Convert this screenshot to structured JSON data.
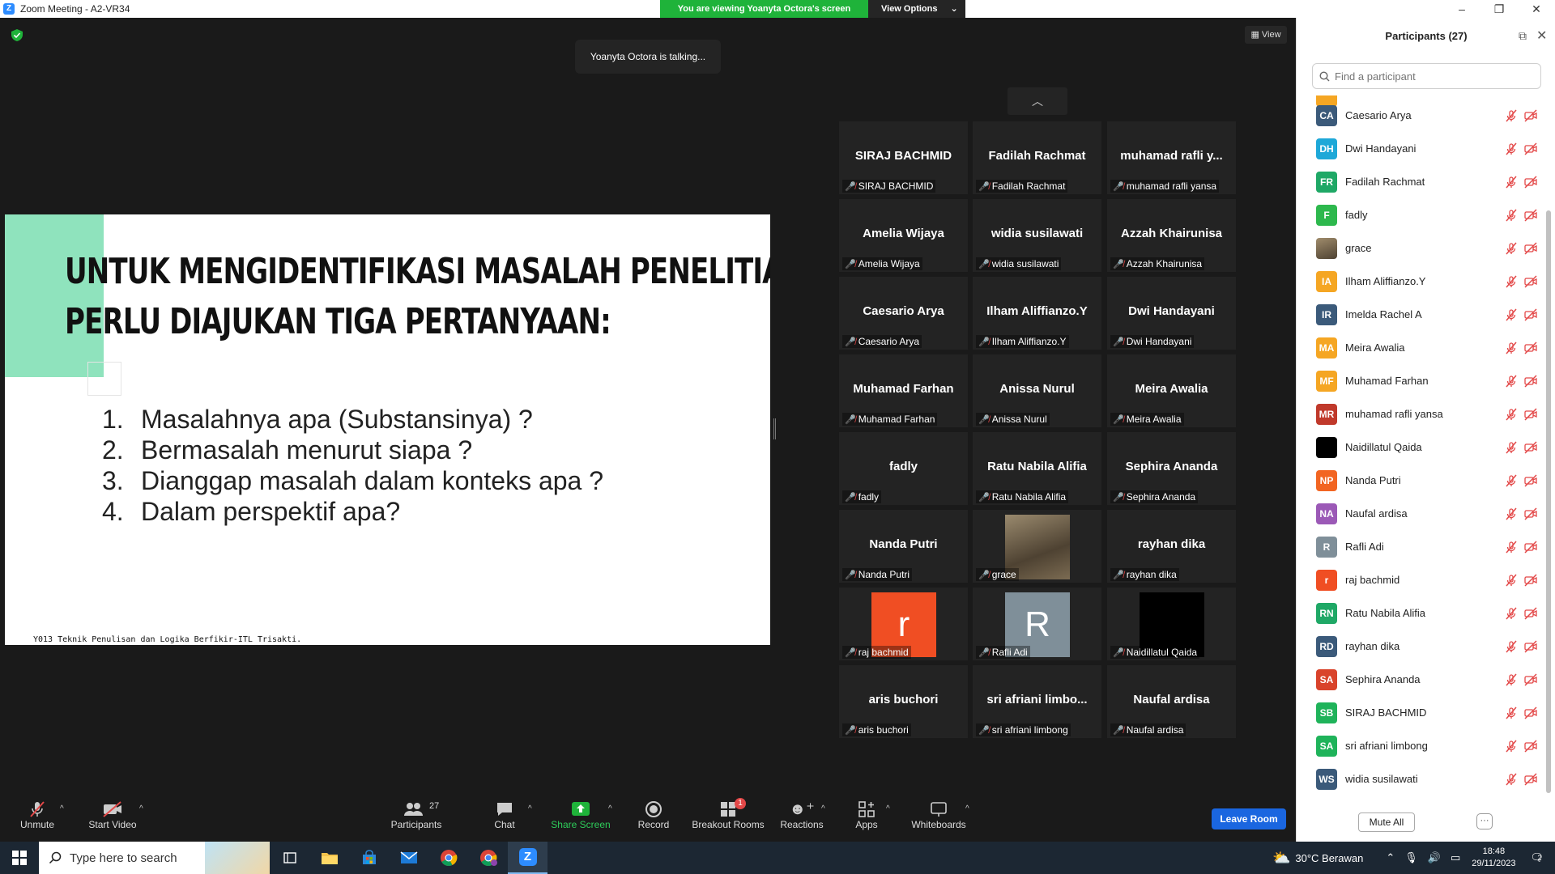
{
  "window": {
    "title": "Zoom Meeting - A2-VR34",
    "app_logo": "Z",
    "controls": [
      "–",
      "❐",
      "✕"
    ]
  },
  "banner": {
    "message": "You are viewing Yoanyta Octora's screen",
    "view_options": "View Options"
  },
  "stage": {
    "talking": "Yoanyta Octora is talking...",
    "view_label": "View"
  },
  "slide": {
    "title_line1": "UNTUK MENGIDENTIFIKASI MASALAH PENELITIAN,",
    "title_line2": "PERLU DIAJUKAN TIGA PERTANYAAN:",
    "items": [
      {
        "num": "1.",
        "text": "Masalahnya apa (Substansinya) ?"
      },
      {
        "num": "2.",
        "text": "Bermasalah menurut siapa ?"
      },
      {
        "num": "3.",
        "text": "Dianggap masalah dalam konteks apa ?"
      },
      {
        "num": "4.",
        "text": "Dalam perspektif apa?"
      }
    ],
    "footer": "Y013 Teknik Penulisan dan Logika Berfikir-ITL Trisakti."
  },
  "gallery": [
    {
      "big": "SIRAJ BACHMID",
      "label": "SIRAJ BACHMID"
    },
    {
      "big": "Fadilah Rachmat",
      "label": "Fadilah Rachmat"
    },
    {
      "big": "muhamad rafli y...",
      "label": "muhamad rafli yansa"
    },
    {
      "big": "Amelia Wijaya",
      "label": "Amelia Wijaya"
    },
    {
      "big": "widia susilawati",
      "label": "widia susilawati"
    },
    {
      "big": "Azzah Khairunisa",
      "label": "Azzah Khairunisa"
    },
    {
      "big": "Caesario Arya",
      "label": "Caesario Arya"
    },
    {
      "big": "Ilham Aliffianzo.Y",
      "label": "Ilham Aliffianzo.Y"
    },
    {
      "big": "Dwi Handayani",
      "label": "Dwi Handayani"
    },
    {
      "big": "Muhamad Farhan",
      "label": "Muhamad Farhan"
    },
    {
      "big": "Anissa Nurul",
      "label": "Anissa Nurul"
    },
    {
      "big": "Meira Awalia",
      "label": "Meira Awalia"
    },
    {
      "big": "fadly",
      "label": "fadly"
    },
    {
      "big": "Ratu Nabila Alifia",
      "label": "Ratu Nabila Alifia"
    },
    {
      "big": "Sephira Ananda",
      "label": "Sephira Ananda"
    },
    {
      "big": "Nanda Putri",
      "label": "Nanda Putri"
    },
    {
      "big": "",
      "label": "grace"
    },
    {
      "big": "rayhan dika",
      "label": "rayhan dika"
    },
    {
      "big": "r",
      "label": "raj bachmid"
    },
    {
      "big": "R",
      "label": "Rafli Adi"
    },
    {
      "big": "",
      "label": "Naidillatul Qaida"
    },
    {
      "big": "aris buchori",
      "label": "aris buchori"
    },
    {
      "big": "sri afriani limbo...",
      "label": "sri afriani limbong"
    },
    {
      "big": "Naufal ardisa",
      "label": "Naufal ardisa"
    }
  ],
  "toolbar": {
    "unmute": "Unmute",
    "start_video": "Start Video",
    "participants": "Participants",
    "participants_count": "27",
    "chat": "Chat",
    "share_screen": "Share Screen",
    "record": "Record",
    "breakout": "Breakout Rooms",
    "breakout_badge": "1",
    "reactions": "Reactions",
    "apps": "Apps",
    "whiteboards": "Whiteboards",
    "leave": "Leave Room"
  },
  "panel": {
    "title": "Participants (27)",
    "search_placeholder": "Find a participant",
    "mute_all": "Mute All",
    "more": "···",
    "participants": [
      {
        "initials": "CA",
        "name": "Caesario Arya",
        "color": "#3b5a7a"
      },
      {
        "initials": "DH",
        "name": "Dwi Handayani",
        "color": "#1ea8d8"
      },
      {
        "initials": "FR",
        "name": "Fadilah Rachmat",
        "color": "#1fa866"
      },
      {
        "initials": "F",
        "name": "fadly",
        "color": "#2db84d"
      },
      {
        "initials": "",
        "name": "grace",
        "color": "#6d5a3e"
      },
      {
        "initials": "IA",
        "name": "Ilham Aliffianzo.Y",
        "color": "#f5a623"
      },
      {
        "initials": "IR",
        "name": "Imelda Rachel A",
        "color": "#3b5a7a"
      },
      {
        "initials": "MA",
        "name": "Meira Awalia",
        "color": "#f5a623"
      },
      {
        "initials": "MF",
        "name": "Muhamad Farhan",
        "color": "#f5a623"
      },
      {
        "initials": "MR",
        "name": "muhamad rafli yansa",
        "color": "#c0392b"
      },
      {
        "initials": "",
        "name": "Naidillatul Qaida",
        "color": "#000000"
      },
      {
        "initials": "NP",
        "name": "Nanda Putri",
        "color": "#f26522"
      },
      {
        "initials": "NA",
        "name": "Naufal ardisa",
        "color": "#9b59b6"
      },
      {
        "initials": "R",
        "name": "Rafli Adi",
        "color": "#7f8f99"
      },
      {
        "initials": "r",
        "name": "raj bachmid",
        "color": "#f04e23"
      },
      {
        "initials": "RN",
        "name": "Ratu Nabila Alifia",
        "color": "#1fa866"
      },
      {
        "initials": "RD",
        "name": "rayhan dika",
        "color": "#3b5a7a"
      },
      {
        "initials": "SA",
        "name": "Sephira Ananda",
        "color": "#d9432b"
      },
      {
        "initials": "SB",
        "name": "SIRAJ BACHMID",
        "color": "#1fb35a"
      },
      {
        "initials": "SA",
        "name": "sri afriani limbong",
        "color": "#1fb35a"
      },
      {
        "initials": "WS",
        "name": "widia susilawati",
        "color": "#3b5a7a"
      }
    ]
  },
  "taskbar": {
    "search_placeholder": "Type here to search",
    "weather": "30°C  Berawan",
    "time": "18:48",
    "date": "29/11/2023",
    "notif_count": "2"
  }
}
